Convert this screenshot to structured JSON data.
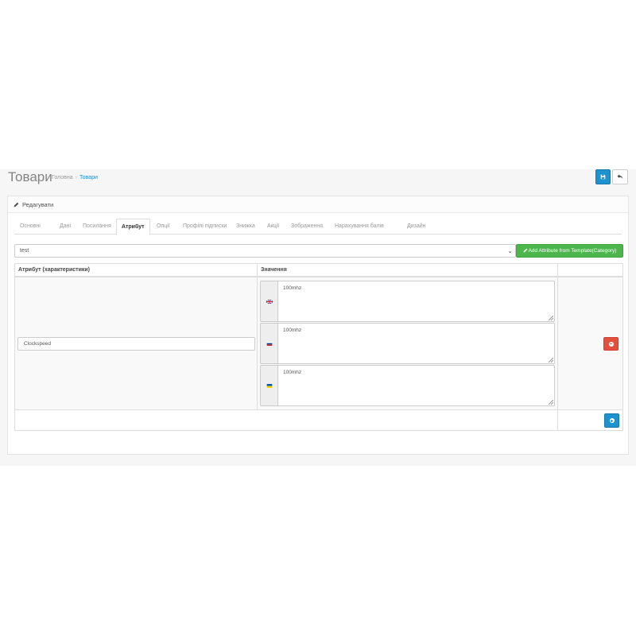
{
  "header": {
    "title": "Товари",
    "breadcrumb": [
      "Головна",
      "Товари"
    ],
    "save_icon": "save-icon",
    "back_icon": "reply-icon"
  },
  "panel": {
    "heading": "Редагувати",
    "heading_icon": "pencil-icon"
  },
  "tabs": [
    {
      "label": "Основні",
      "active": false
    },
    {
      "label": "Дані",
      "active": false
    },
    {
      "label": "Посилання",
      "active": false
    },
    {
      "label": "Атрибут",
      "active": true
    },
    {
      "label": "Опції",
      "active": false
    },
    {
      "label": "Профілі підписки",
      "active": false
    },
    {
      "label": "Знижка",
      "active": false
    },
    {
      "label": "Акції",
      "active": false
    },
    {
      "label": "Зображення",
      "active": false
    },
    {
      "label": "Нарахування балів",
      "active": false
    },
    {
      "label": "Дизайн",
      "active": false
    }
  ],
  "template_select": {
    "value": "test",
    "add_button_label": "Add Attribute from Template(Category)"
  },
  "table": {
    "columns": [
      "Атрибут (характеристики)",
      "Значення",
      ""
    ],
    "rows": [
      {
        "attribute": "Clockspeed",
        "values": [
          {
            "lang": "en",
            "flag": "uk-flag-icon",
            "text": "100mhz"
          },
          {
            "lang": "ru",
            "flag": "ru-flag-icon",
            "text": "100mhz"
          },
          {
            "lang": "ua",
            "flag": "ua-flag-icon",
            "text": "100mhz"
          }
        ]
      }
    ]
  },
  "colors": {
    "primary": "#1e91cf",
    "success": "#4cb64c",
    "danger": "#e3503e"
  }
}
